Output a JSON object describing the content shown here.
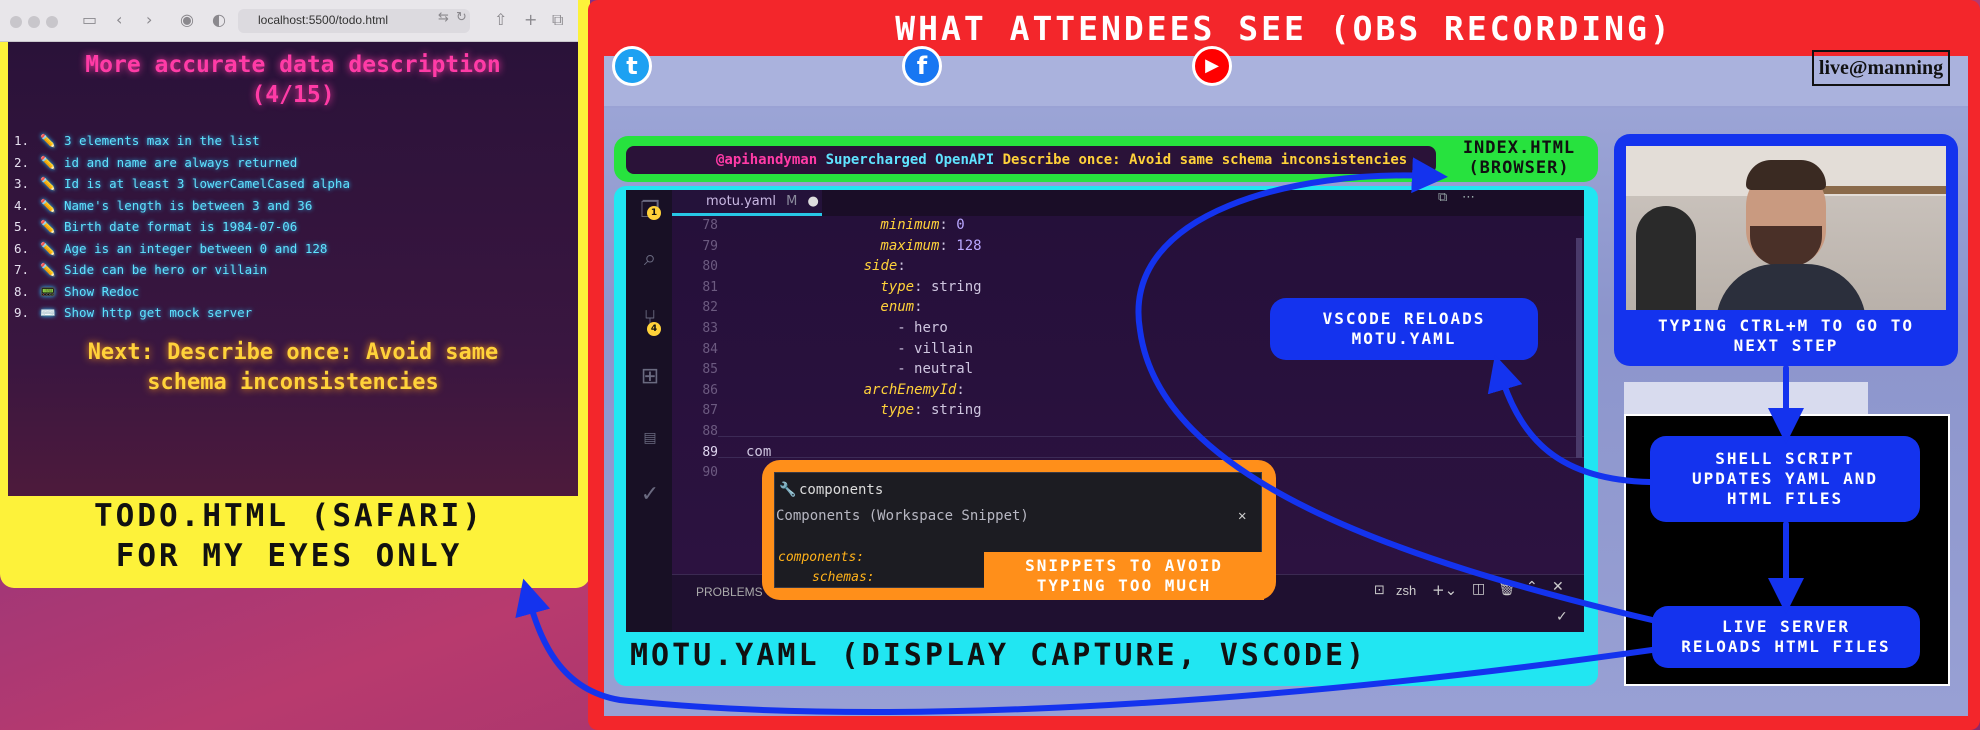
{
  "safari": {
    "url": "localhost:5500/todo.html"
  },
  "todo": {
    "title_line1": "More accurate data description",
    "title_line2": "(4/15)",
    "items": [
      {
        "num": "1.",
        "icon": "✏️",
        "text": "3 elements max in the list"
      },
      {
        "num": "2.",
        "icon": "✏️",
        "text": "id and name are always returned"
      },
      {
        "num": "3.",
        "icon": "✏️",
        "text": "Id is at least 3 lowerCamelCased alpha"
      },
      {
        "num": "4.",
        "icon": "✏️",
        "text": "Name's length is between 3 and 36"
      },
      {
        "num": "5.",
        "icon": "✏️",
        "text": "Birth date format is 1984-07-06"
      },
      {
        "num": "6.",
        "icon": "✏️",
        "text": "Age is an integer between 0 and 128"
      },
      {
        "num": "7.",
        "icon": "✏️",
        "text": "Side can be hero or villain"
      },
      {
        "num": "8.",
        "icon": "📟",
        "text": "Show Redoc"
      },
      {
        "num": "9.",
        "icon": "⌨️",
        "text": "Show http get mock server"
      }
    ],
    "next_line1": "Next: Describe once: Avoid same",
    "next_line2": "schema inconsistencies",
    "caption_line1": "TODO.HTML (SAFARI)",
    "caption_line2": "FOR MY EYES ONLY"
  },
  "obs": {
    "title": "WHAT ATTENDEES SEE (OBS RECORDING)",
    "brand": "live@manning",
    "index_banner": {
      "handle": "@apihandyman",
      "brand": "Supercharged OpenAPI",
      "step": "Describe once: Avoid same schema inconsistencies"
    },
    "index_label_line1": "INDEX.HTML",
    "index_label_line2": "(BROWSER)",
    "vscode": {
      "tab": "motu.yaml",
      "tab_modified": "M",
      "badge_explorer": "1",
      "badge_scm": "4",
      "lines": [
        {
          "n": "78",
          "indent": 16,
          "key": "minimum",
          "val": "0",
          "vclass": "v"
        },
        {
          "n": "79",
          "indent": 16,
          "key": "maximum",
          "val": "128",
          "vclass": "v"
        },
        {
          "n": "80",
          "indent": 14,
          "key": "side",
          "val": "",
          "vclass": "p"
        },
        {
          "n": "81",
          "indent": 16,
          "key": "type",
          "val": "string",
          "vclass": "p"
        },
        {
          "n": "82",
          "indent": 16,
          "key": "enum",
          "val": "",
          "vclass": "p"
        },
        {
          "n": "83",
          "indent": 18,
          "key": "",
          "val": "- hero",
          "vclass": "p"
        },
        {
          "n": "84",
          "indent": 18,
          "key": "",
          "val": "- villain",
          "vclass": "p"
        },
        {
          "n": "85",
          "indent": 18,
          "key": "",
          "val": "- neutral",
          "vclass": "p"
        },
        {
          "n": "86",
          "indent": 14,
          "key": "archEnemyId",
          "val": "",
          "vclass": "p"
        },
        {
          "n": "87",
          "indent": 16,
          "key": "type",
          "val": "string",
          "vclass": "p"
        },
        {
          "n": "88",
          "indent": 0,
          "key": "",
          "val": "",
          "vclass": "p"
        },
        {
          "n": "89",
          "indent": 0,
          "key": "",
          "val": "com",
          "vclass": "p"
        },
        {
          "n": "90",
          "indent": 0,
          "key": "",
          "val": "",
          "vclass": "p"
        }
      ],
      "suggest_label": "components",
      "suggest_detail": "Components (Workspace Snippet)",
      "snippet_key": "components:",
      "snippet_child": "schemas:",
      "panel_problems": "PROBLEMS",
      "terminal_name": "zsh"
    },
    "snippet_callout_line1": "SNIPPETS TO AVOID",
    "snippet_callout_line2": "TYPING TOO MUCH",
    "motu_caption": "MOTU.YAML (DISPLAY CAPTURE, VSCODE)",
    "vscode_reloads_line1": "VSCODE RELOADS",
    "vscode_reloads_line2": "MOTU.YAML",
    "cam_label_line1": "TYPING CTRL+M TO GO TO",
    "cam_label_line2": "NEXT STEP",
    "shell_line1": "SHELL SCRIPT",
    "shell_line2": "UPDATES YAML AND",
    "shell_line3": "HTML FILES",
    "live_line1": "LIVE SERVER",
    "live_line2": "RELOADS HTML FILES"
  },
  "colors": {
    "yellow": "#fdf23a",
    "red": "#f3262b",
    "green": "#27e23e",
    "cyan": "#21e6f2",
    "orange": "#ff8f1a",
    "blue": "#1433ee",
    "neon_pink": "#ff3ba6",
    "neon_cyan": "#5fe3ff"
  }
}
